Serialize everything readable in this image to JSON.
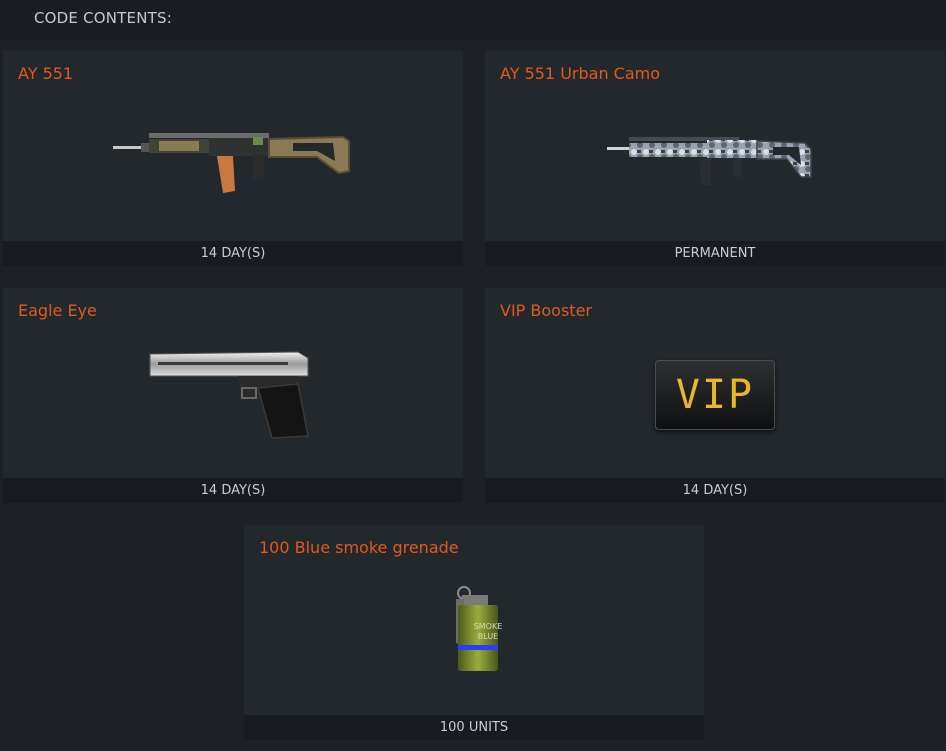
{
  "header": {
    "title": "CODE CONTENTS:"
  },
  "items": [
    {
      "name": "AY 551",
      "duration": "14 DAY(S)",
      "icon": "assault-rifle-icon"
    },
    {
      "name": "AY 551 Urban Camo",
      "duration": "PERMANENT",
      "icon": "assault-rifle-urban-camo-icon"
    },
    {
      "name": "Eagle Eye",
      "duration": "14 DAY(S)",
      "icon": "pistol-icon"
    },
    {
      "name": "VIP Booster",
      "duration": "14 DAY(S)",
      "icon": "vip-badge-icon",
      "badge_text": "VIP"
    },
    {
      "name": "100 Blue smoke grenade",
      "duration": "100 UNITS",
      "icon": "smoke-grenade-icon",
      "label_lines": [
        "SMOKE",
        "BLUE"
      ]
    }
  ],
  "colors": {
    "accent": "#e05a1c",
    "card_bg": "#23282d",
    "footer_bg": "#181b1f",
    "vip_text": "#e8b62c"
  }
}
